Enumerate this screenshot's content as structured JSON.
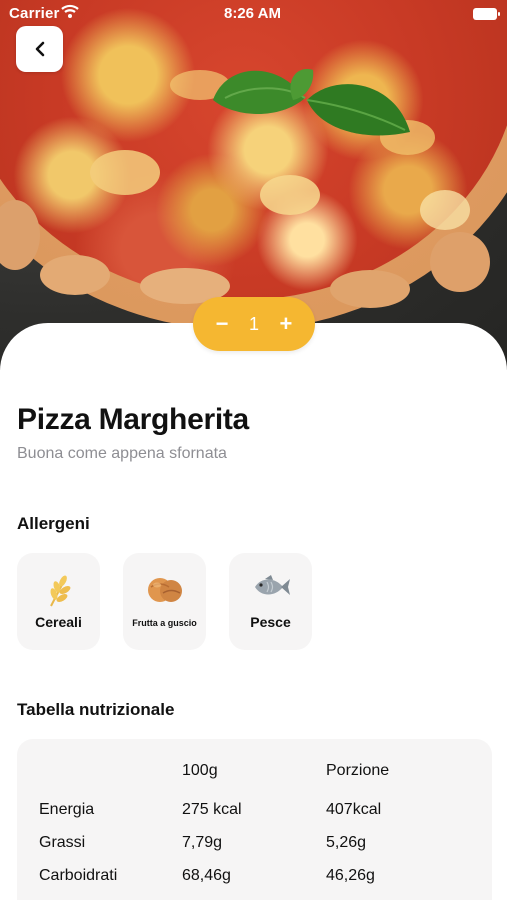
{
  "status_bar": {
    "carrier": "Carrier",
    "time": "8:26 AM"
  },
  "header": {
    "back_icon": "chevron-left-icon"
  },
  "quantity": {
    "decrement": "−",
    "value": "1",
    "increment": "+"
  },
  "product": {
    "name": "Pizza Margherita",
    "tagline": "Buona come appena sfornata"
  },
  "allergens": {
    "heading": "Allergeni",
    "items": [
      {
        "label": "Cereali",
        "icon": "wheat-icon"
      },
      {
        "label": "Frutta a guscio",
        "icon": "nuts-icon"
      },
      {
        "label": "Pesce",
        "icon": "fish-icon"
      }
    ]
  },
  "nutrition": {
    "heading": "Tabella nutrizionale",
    "columns": [
      "100g",
      "Porzione"
    ],
    "rows": [
      {
        "name": "Energia",
        "per100g": "275 kcal",
        "portion": "407kcal"
      },
      {
        "name": "Grassi",
        "per100g": "7,79g",
        "portion": "5,26g"
      },
      {
        "name": "Carboidrati",
        "per100g": "68,46g",
        "portion": "46,26g"
      }
    ]
  },
  "colors": {
    "accent": "#f5b731",
    "card_background": "#f6f5f5",
    "muted_text": "#8e8e93"
  }
}
